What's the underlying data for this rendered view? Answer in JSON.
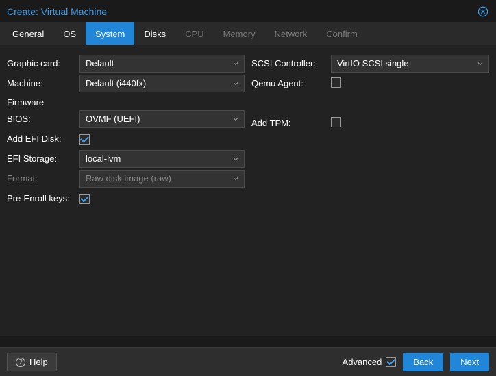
{
  "title": "Create: Virtual Machine",
  "tabs": [
    {
      "label": "General",
      "active": false,
      "disabled": false
    },
    {
      "label": "OS",
      "active": false,
      "disabled": false
    },
    {
      "label": "System",
      "active": true,
      "disabled": false
    },
    {
      "label": "Disks",
      "active": false,
      "disabled": false
    },
    {
      "label": "CPU",
      "active": false,
      "disabled": true
    },
    {
      "label": "Memory",
      "active": false,
      "disabled": true
    },
    {
      "label": "Network",
      "active": false,
      "disabled": true
    },
    {
      "label": "Confirm",
      "active": false,
      "disabled": true
    }
  ],
  "left": {
    "graphic_label": "Graphic card:",
    "graphic_value": "Default",
    "machine_label": "Machine:",
    "machine_value": "Default (i440fx)",
    "firmware_label": "Firmware",
    "bios_label": "BIOS:",
    "bios_value": "OVMF (UEFI)",
    "add_efi_label": "Add EFI Disk:",
    "add_efi_checked": true,
    "efi_storage_label": "EFI Storage:",
    "efi_storage_value": "local-lvm",
    "format_label": "Format:",
    "format_value": "Raw disk image (raw)",
    "preenroll_label": "Pre-Enroll keys:",
    "preenroll_checked": true
  },
  "right": {
    "scsi_label": "SCSI Controller:",
    "scsi_value": "VirtIO SCSI single",
    "qemu_agent_label": "Qemu Agent:",
    "qemu_agent_checked": false,
    "add_tpm_label": "Add TPM:",
    "add_tpm_checked": false
  },
  "footer": {
    "help": "Help",
    "advanced": "Advanced",
    "advanced_checked": true,
    "back": "Back",
    "next": "Next"
  }
}
